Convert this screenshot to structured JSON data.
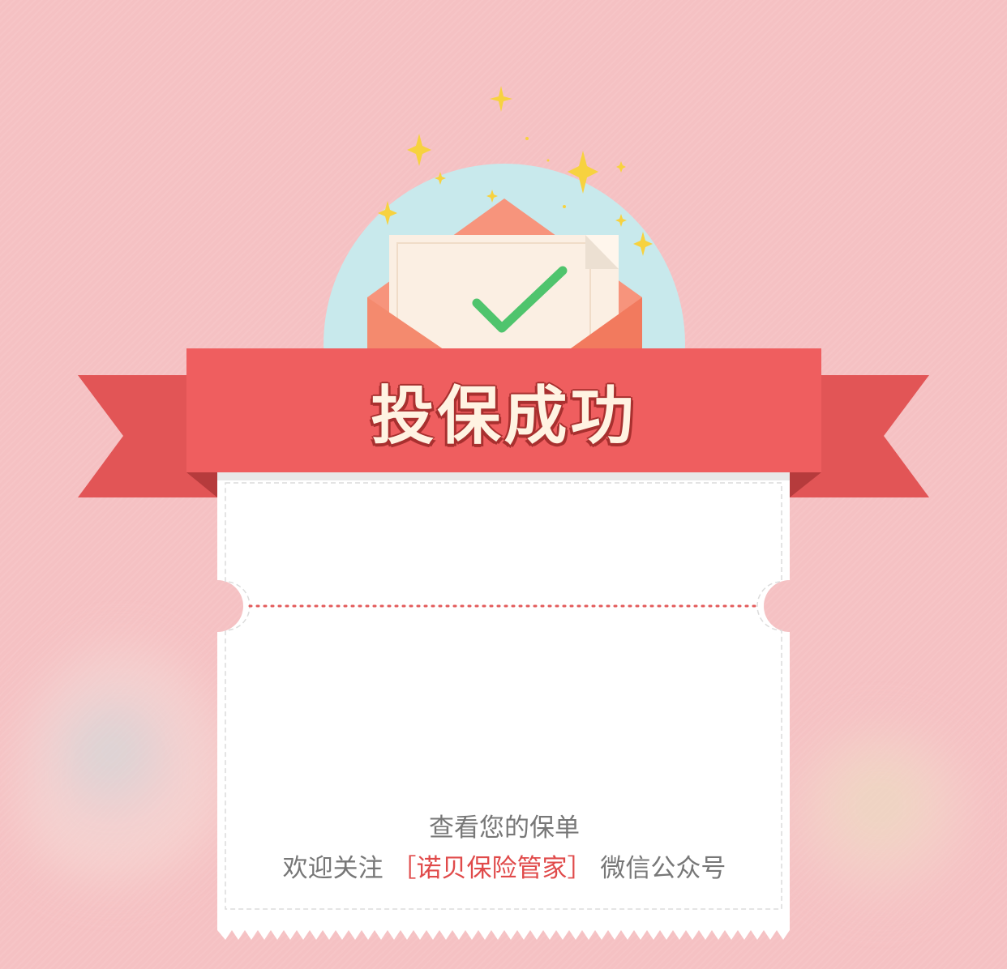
{
  "title": "投保成功",
  "ticket": {
    "line1": "查看您的保单",
    "line2_prefix": "欢迎关注",
    "bracket_open": "［",
    "brand": "诺贝保险管家",
    "bracket_close": "］",
    "line2_suffix": "微信公众号"
  },
  "icons": {
    "envelope": "envelope-check-icon",
    "sparkles": "sparkle-icon"
  },
  "colors": {
    "background": "#f5c1c3",
    "ribbon": "#ef5e5f",
    "ribbon_dark": "#de5050",
    "check": "#4fc46d",
    "brand_text": "#e04a4a"
  }
}
